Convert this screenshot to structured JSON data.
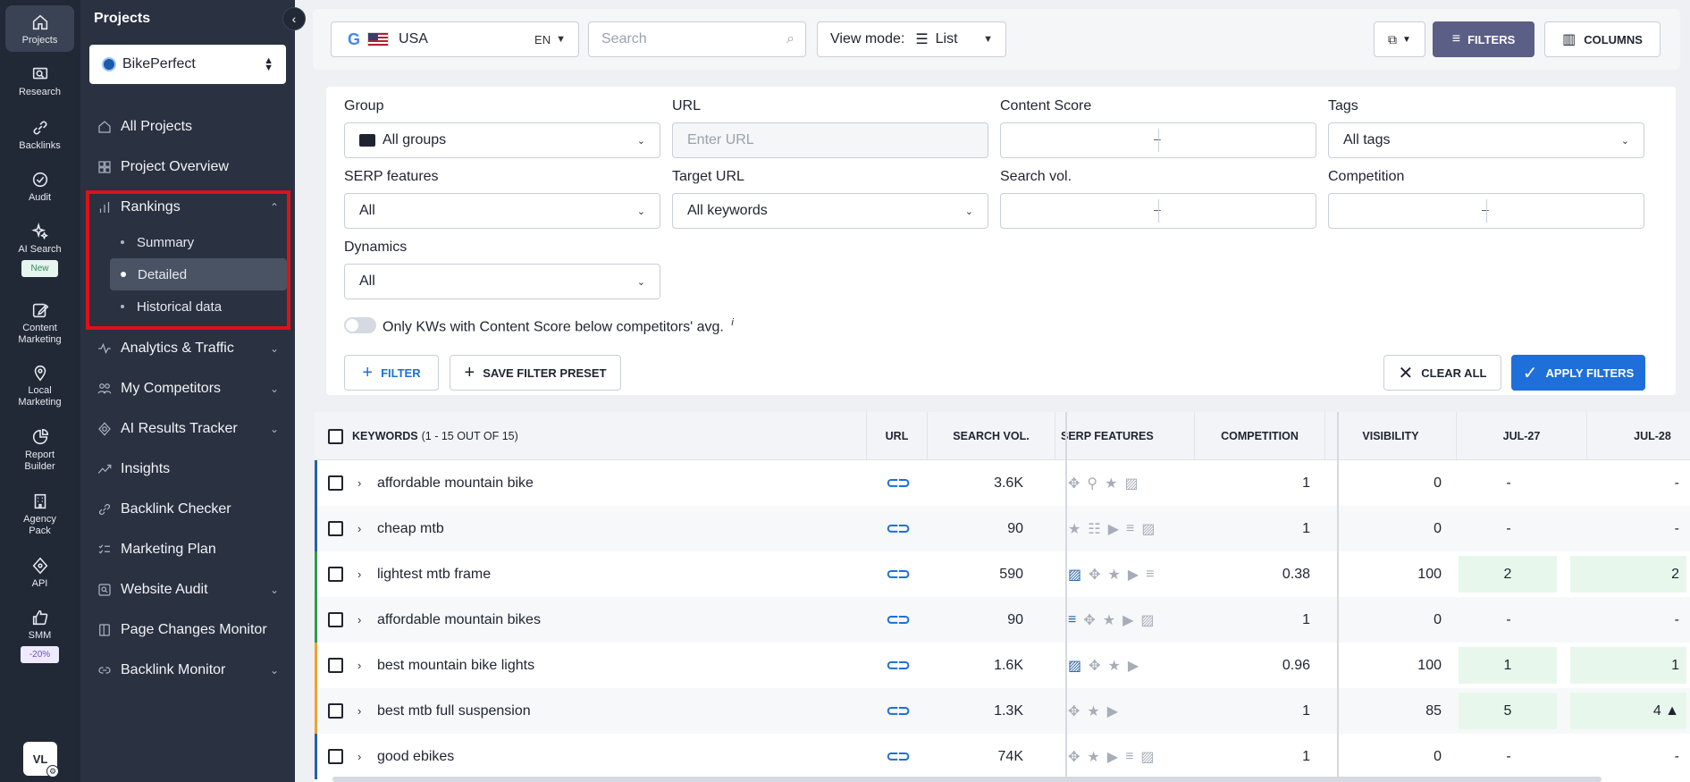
{
  "rail": [
    {
      "label": "Projects",
      "icon": "home-icon",
      "active": true
    },
    {
      "label": "Research",
      "icon": "research-icon"
    },
    {
      "label": "Backlinks",
      "icon": "link-icon"
    },
    {
      "label": "Audit",
      "icon": "audit-icon"
    },
    {
      "label": "AI Search",
      "icon": "sparkle-icon",
      "badge": "New"
    },
    {
      "label": "Content Marketing",
      "icon": "edit-icon"
    },
    {
      "label": "Local Marketing",
      "icon": "pin-icon"
    },
    {
      "label": "Report Builder",
      "icon": "report-icon"
    },
    {
      "label": "Agency Pack",
      "icon": "building-icon"
    },
    {
      "label": "API",
      "icon": "api-icon"
    },
    {
      "label": "SMM",
      "icon": "thumb-icon",
      "badge": "-20%"
    }
  ],
  "user": {
    "initials": "VL"
  },
  "sidebar": {
    "title": "Projects",
    "project": "BikePerfect",
    "items": [
      {
        "label": "All Projects"
      },
      {
        "label": "Project Overview"
      },
      {
        "label": "Rankings",
        "expanded": true
      },
      {
        "label": "Analytics & Traffic"
      },
      {
        "label": "My Competitors"
      },
      {
        "label": "AI Results Tracker"
      },
      {
        "label": "Insights"
      },
      {
        "label": "Backlink Checker"
      },
      {
        "label": "Marketing Plan"
      },
      {
        "label": "Website Audit"
      },
      {
        "label": "Page Changes Monitor"
      },
      {
        "label": "Backlink Monitor"
      }
    ],
    "rankings_sub": [
      {
        "label": "Summary"
      },
      {
        "label": "Detailed",
        "active": true
      },
      {
        "label": "Historical data"
      }
    ]
  },
  "topbar": {
    "engine": "G",
    "country": "USA",
    "lang": "EN",
    "search_placeholder": "Search",
    "view_mode_label": "View mode:",
    "view_mode_value": "List",
    "filters_label": "FILTERS",
    "columns_label": "COLUMNS"
  },
  "filters": {
    "group_label": "Group",
    "group_value": "All groups",
    "url_label": "URL",
    "url_placeholder": "Enter URL",
    "content_score_label": "Content Score",
    "tags_label": "Tags",
    "tags_value": "All tags",
    "serp_label": "SERP features",
    "serp_value": "All",
    "target_url_label": "Target URL",
    "target_url_value": "All keywords",
    "search_vol_label": "Search vol.",
    "competition_label": "Competition",
    "dynamics_label": "Dynamics",
    "dynamics_value": "All",
    "toggle_label": "Only KWs with Content Score below competitors' avg.",
    "toggle_info": "i",
    "filter_btn": "FILTER",
    "save_preset_btn": "SAVE FILTER PRESET",
    "clear_all_btn": "CLEAR ALL",
    "apply_btn": "APPLY FILTERS"
  },
  "table": {
    "headers": {
      "keywords": "KEYWORDS",
      "keywords_count": "(1 - 15 OUT OF 15)",
      "url": "URL",
      "search_vol": "SEARCH VOL.",
      "serp": "SERP FEATURES",
      "competition": "COMPETITION",
      "visibility": "VISIBILITY",
      "d1": "JUL-27",
      "d2": "JUL-28"
    },
    "rows": [
      {
        "keyword": "affordable mountain bike",
        "vol": "3.6K",
        "comp": "1",
        "vis": "0",
        "d1": "-",
        "d2": "-",
        "accent": "#2760a8",
        "d1g": false,
        "d2g": false
      },
      {
        "keyword": "cheap mtb",
        "vol": "90",
        "comp": "1",
        "vis": "0",
        "d1": "-",
        "d2": "-",
        "accent": "#2760a8",
        "d1g": false,
        "d2g": false
      },
      {
        "keyword": "lightest mtb frame",
        "vol": "590",
        "comp": "0.38",
        "vis": "100",
        "d1": "2",
        "d2": "2",
        "accent": "#2e9b4e",
        "d1g": true,
        "d2g": true
      },
      {
        "keyword": "affordable mountain bikes",
        "vol": "90",
        "comp": "1",
        "vis": "0",
        "d1": "-",
        "d2": "-",
        "accent": "#2e9b4e",
        "d1g": false,
        "d2g": false
      },
      {
        "keyword": "best mountain bike lights",
        "vol": "1.6K",
        "comp": "0.96",
        "vis": "100",
        "d1": "1",
        "d2": "1",
        "accent": "#f0a030",
        "d1g": true,
        "d2g": true
      },
      {
        "keyword": "best mtb full suspension",
        "vol": "1.3K",
        "comp": "1",
        "vis": "85",
        "d1": "5",
        "d2": "4 ▲",
        "accent": "#f0a030",
        "d1g": true,
        "d2g": true
      },
      {
        "keyword": "good ebikes",
        "vol": "74K",
        "comp": "1",
        "vis": "0",
        "d1": "-",
        "d2": "-",
        "accent": "#2760a8",
        "d1g": false,
        "d2g": false
      }
    ]
  }
}
